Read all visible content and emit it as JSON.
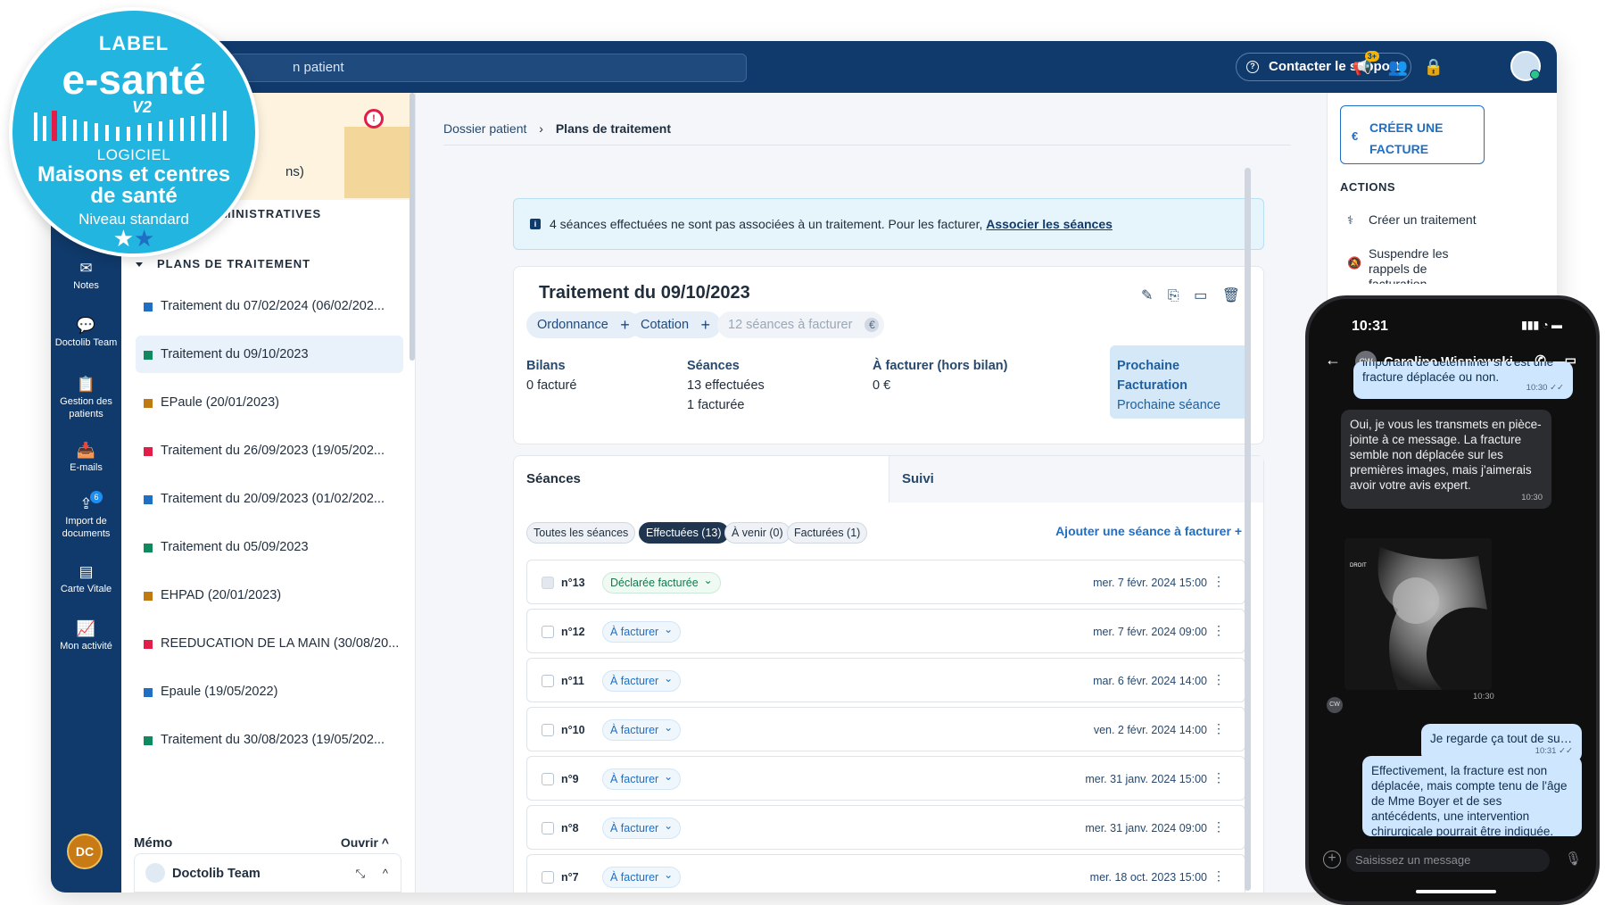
{
  "topbar": {
    "search_placeholder": "n patient",
    "support_label": "Contacter le support",
    "notif_badge": "3+"
  },
  "label_badge": {
    "line1": "LABEL",
    "line2": "e-santé",
    "version": "V2",
    "line3": "LOGICIEL",
    "line4": "Maisons et centres",
    "line5": "de santé",
    "line6": "Niveau standard"
  },
  "nav": {
    "items": [
      {
        "label": "Notes",
        "icon": "envelope-icon"
      },
      {
        "label": "Doctolib Team",
        "icon": "chat-icon"
      },
      {
        "label": "Gestion des patients",
        "icon": "clipboard-icon"
      },
      {
        "label": "E-mails",
        "icon": "inbox-icon"
      },
      {
        "label": "Import de documents",
        "icon": "upload-icon",
        "badge": "6"
      },
      {
        "label": "Carte Vitale",
        "icon": "card-icon"
      },
      {
        "label": "Mon activité",
        "icon": "chart-icon"
      }
    ],
    "avatar_initials": "DC"
  },
  "sidebar": {
    "patient_alert": "!",
    "patient_suffix": "ns)",
    "section_admin": "ADMINISTRATIVES",
    "section_plans": "PLANS DE TRAITEMENT",
    "plans": [
      {
        "label": "Traitement du 07/02/2024 (06/02/202...",
        "color": "#1f6fc4"
      },
      {
        "label": "Traitement du 09/10/2023",
        "color": "#0e8a5e",
        "active": true
      },
      {
        "label": "EPaule (20/01/2023)",
        "color": "#c07a10"
      },
      {
        "label": "Traitement du 26/09/2023 (19/05/202...",
        "color": "#e11d48"
      },
      {
        "label": "Traitement du 20/09/2023 (01/02/202...",
        "color": "#1f6fc4"
      },
      {
        "label": "Traitement du 05/09/2023",
        "color": "#0e8a5e"
      },
      {
        "label": "EHPAD (20/01/2023)",
        "color": "#c07a10"
      },
      {
        "label": "REEDUCATION DE LA MAIN (30/08/20...",
        "color": "#e11d48"
      },
      {
        "label": "Epaule (19/05/2022)",
        "color": "#1f6fc4"
      },
      {
        "label": "Traitement du 30/08/2023 (19/05/202...",
        "color": "#0e8a5e"
      }
    ],
    "memo_label": "Mémo",
    "memo_open": "Ouvrir",
    "team_chat": "Doctolib Team"
  },
  "main": {
    "breadcrumb": {
      "parent": "Dossier patient",
      "current": "Plans de traitement"
    },
    "banner": {
      "text": "4 séances effectuées ne sont pas associées à un traitement. Pour les facturer, ",
      "link": "Associer les séances"
    },
    "treatment": {
      "title": "Traitement du 09/10/2023",
      "chips": {
        "ordonnance": "Ordonnance",
        "cotation": "Cotation",
        "seances": "12 séances à facturer"
      },
      "bilans_h": "Bilans",
      "bilans_v": "0 facturé",
      "seances_h": "Séances",
      "seances_v1": "13 effectuées",
      "seances_v2": "1 facturée",
      "afacturer_h": "À facturer (hors bilan)",
      "afacturer_v": "0 €",
      "next_h": "Prochaine Facturation",
      "next_v": "Prochaine séance"
    },
    "tabs": {
      "seances": "Séances",
      "suivi": "Suivi"
    },
    "filters": {
      "all": "Toutes les séances",
      "done": "Effectuées (13)",
      "upcoming": "À venir (0)",
      "billed": "Facturées (1)"
    },
    "add_session": "Ajouter une séance à facturer",
    "sessions": [
      {
        "num": "n°13",
        "status": "Déclarée facturée",
        "date": "mer. 7 févr. 2024 15:00"
      },
      {
        "num": "n°12",
        "status": "À facturer",
        "date": "mer. 7 févr. 2024 09:00"
      },
      {
        "num": "n°11",
        "status": "À facturer",
        "date": "mar. 6 févr. 2024 14:00"
      },
      {
        "num": "n°10",
        "status": "À facturer",
        "date": "ven. 2 févr. 2024 14:00"
      },
      {
        "num": "n°9",
        "status": "À facturer",
        "date": "mer. 31 janv. 2024 15:00"
      },
      {
        "num": "n°8",
        "status": "À facturer",
        "date": "mer. 31 janv. 2024 09:00"
      },
      {
        "num": "n°7",
        "status": "À facturer",
        "date": "mer. 18 oct. 2023 15:00"
      }
    ]
  },
  "right": {
    "invoice_line1": "CRÉER UNE",
    "invoice_line2": "FACTURE",
    "actions_head": "ACTIONS",
    "action1": "Créer un traitement",
    "action2_l1": "Suspendre les",
    "action2_l2": "rappels de",
    "action2_l3": "facturation"
  },
  "phone": {
    "time": "10:31",
    "contact_initials": "CW",
    "contact_name": "Caroline Wisniewski",
    "messages": [
      {
        "from": "me",
        "text": "important de déterminer si c'est une fracture déplacée ou non.",
        "time": "10:30 ✓✓"
      },
      {
        "from": "them",
        "text": "Oui, je vous les transmets en pièce-jointe à ce message. La fracture semble non déplacée sur les premières images, mais j'aimerais avoir votre avis expert.",
        "time": "10:30"
      },
      {
        "from": "me",
        "text": "Je regarde ça tout de suite...",
        "time": "10:31 ✓✓"
      },
      {
        "from": "them",
        "text": "Effectivement, la fracture est non déplacée, mais compte tenu de l'âge de Mme Boyer et de ses antécédents, une intervention chirurgicale pourrait être indiquée.  Que pensez-vous de",
        "time": ""
      }
    ],
    "xray_label": "DROIT",
    "xray_time": "10:30",
    "input_placeholder": "Saisissez un message"
  }
}
